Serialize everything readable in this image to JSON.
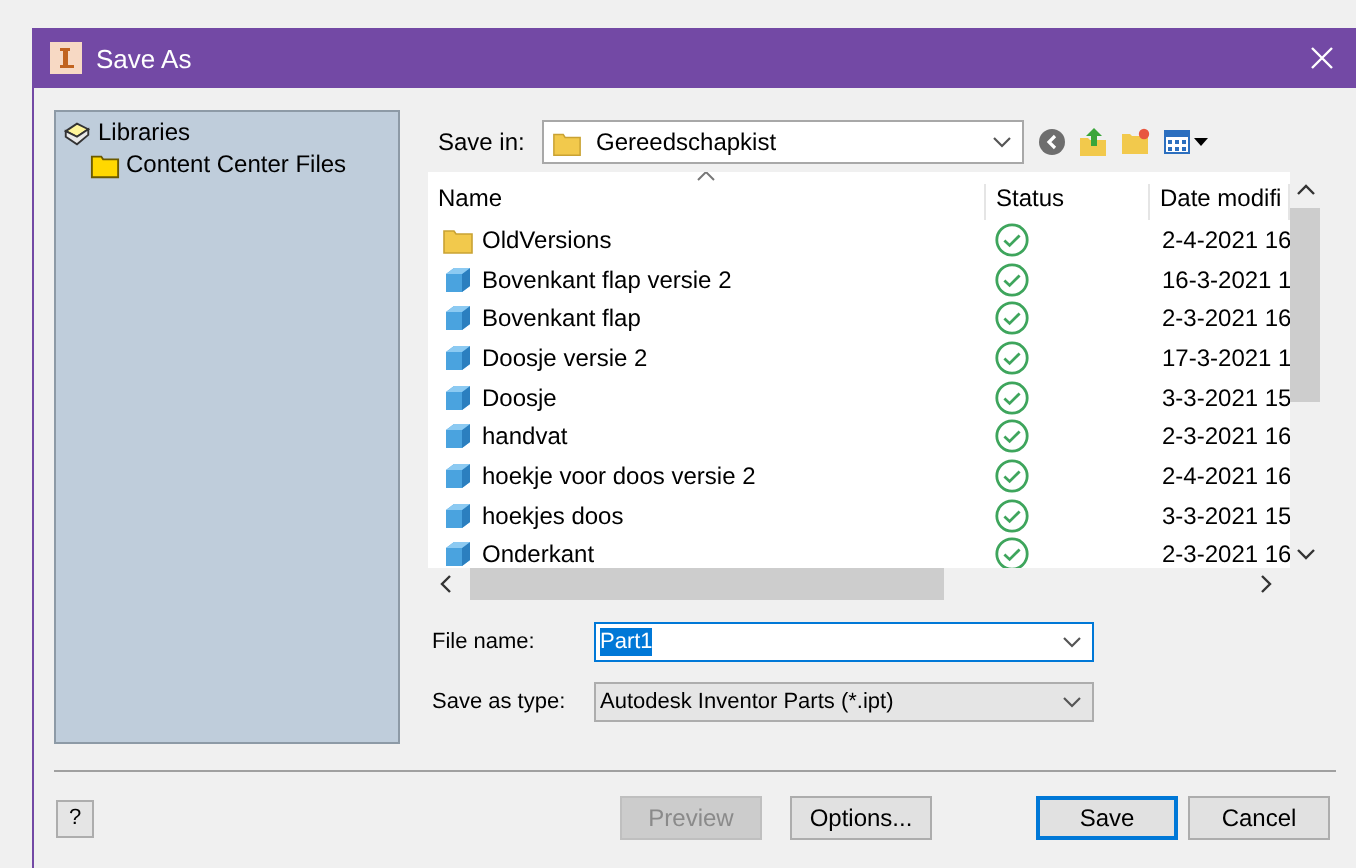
{
  "window": {
    "title": "Save As"
  },
  "sidebar": {
    "items": [
      {
        "label": "Libraries",
        "kind": "library",
        "children": [
          {
            "label": "Content Center Files",
            "kind": "folder"
          }
        ]
      }
    ]
  },
  "save_in": {
    "label": "Save in:",
    "value": "Gereedschapkist"
  },
  "file_list": {
    "columns": [
      "Name",
      "Status",
      "Date modifi"
    ],
    "rows": [
      {
        "name": "OldVersions",
        "kind": "folder",
        "up_to_date": true,
        "date": "2-4-2021 16"
      },
      {
        "name": "Bovenkant flap versie 2",
        "kind": "part",
        "up_to_date": true,
        "date": "16-3-2021 1"
      },
      {
        "name": "Bovenkant flap",
        "kind": "part",
        "up_to_date": true,
        "date": "2-3-2021 16"
      },
      {
        "name": "Doosje versie 2",
        "kind": "part",
        "up_to_date": true,
        "date": "17-3-2021 1"
      },
      {
        "name": "Doosje",
        "kind": "part",
        "up_to_date": true,
        "date": "3-3-2021 15"
      },
      {
        "name": "handvat",
        "kind": "part",
        "up_to_date": true,
        "date": "2-3-2021 16"
      },
      {
        "name": "hoekje voor doos versie 2",
        "kind": "part",
        "up_to_date": true,
        "date": "2-4-2021 16"
      },
      {
        "name": "hoekjes doos",
        "kind": "part",
        "up_to_date": true,
        "date": "3-3-2021 15"
      },
      {
        "name": "Onderkant",
        "kind": "part",
        "up_to_date": true,
        "date": "2-3-2021 16"
      }
    ]
  },
  "file_name": {
    "label": "File name:",
    "value": "Part1",
    "selected": true
  },
  "save_as_type": {
    "label": "Save as type:",
    "value": "Autodesk Inventor Parts (*.ipt)"
  },
  "help": "?",
  "buttons": [
    {
      "label": "Preview",
      "disabled": true,
      "default": false
    },
    {
      "label": "Options...",
      "disabled": false,
      "default": false
    },
    {
      "label": "Save",
      "disabled": false,
      "default": true
    },
    {
      "label": "Cancel",
      "disabled": false,
      "default": false
    }
  ]
}
